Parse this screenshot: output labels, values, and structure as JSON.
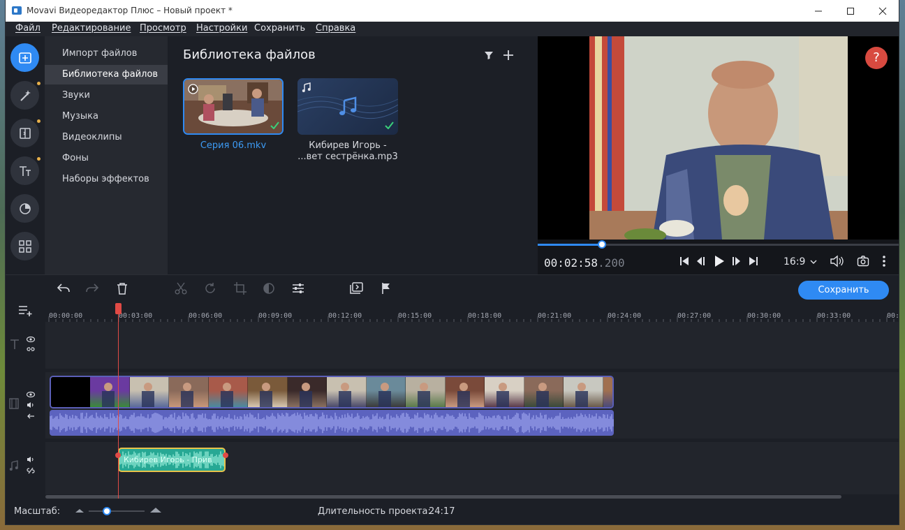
{
  "window": {
    "title": "Movavi Видеоредактор Плюс – Новый проект *"
  },
  "menu": {
    "items": [
      "Файл",
      "Редактирование",
      "Просмотр",
      "Настройки",
      "Сохранить",
      "Справка"
    ]
  },
  "left_tools": [
    "import-icon",
    "magic-wand-icon",
    "transitions-icon",
    "titles-icon",
    "filters-icon",
    "more-tools-icon"
  ],
  "nav": {
    "items": [
      "Импорт файлов",
      "Библиотека файлов",
      "Звуки",
      "Музыка",
      "Видеоклипы",
      "Фоны",
      "Наборы эффектов"
    ],
    "selected": 1
  },
  "library": {
    "title": "Библиотека файлов",
    "files": [
      {
        "name": "Серия 06.mkv",
        "type": "video"
      },
      {
        "name_line1": "Кибирев Игорь -",
        "name_line2": "...вет сестрёнка.mp3",
        "type": "audio"
      }
    ]
  },
  "player": {
    "time_main": "00:02:58",
    "time_ms": ".200",
    "aspect": "16:9",
    "progress": 0.178
  },
  "toolbar": {
    "save_label": "Сохранить"
  },
  "ruler": {
    "ticks": [
      "00:00:00",
      "00:03:00",
      "00:06:00",
      "00:09:00",
      "00:12:00",
      "00:15:00",
      "00:18:00",
      "00:21:00",
      "00:24:00",
      "00:27:00",
      "00:30:00",
      "00:33:00",
      "00:3"
    ]
  },
  "timeline": {
    "music_clip_label": "Кибирев Игорь - Прив"
  },
  "status": {
    "scale_label": "Масштаб:",
    "duration_label": "Длительность проекта:",
    "duration_value": "24:17"
  },
  "colors": {
    "accent": "#2f8af3",
    "playhead": "#e04a45",
    "audio_wave": "#5f6fcf",
    "music_clip": "#29b39a",
    "clip_border": "#e8c34a"
  }
}
